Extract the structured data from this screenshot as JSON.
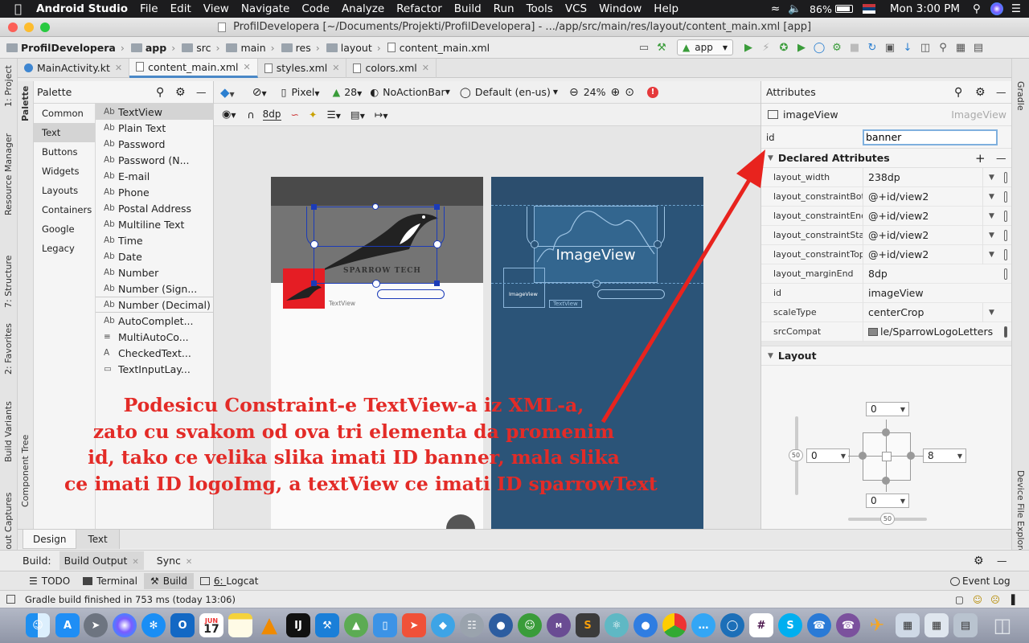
{
  "menubar": {
    "app": "Android Studio",
    "items": [
      "File",
      "Edit",
      "View",
      "Navigate",
      "Code",
      "Analyze",
      "Refactor",
      "Build",
      "Run",
      "Tools",
      "VCS",
      "Window",
      "Help"
    ],
    "battery": "86%",
    "clock": "Mon 3:00 PM"
  },
  "window": {
    "title": "ProfilDevelopera [~/Documents/Projekti/ProfilDevelopera] - .../app/src/main/res/layout/content_main.xml [app]"
  },
  "breadcrumbs": [
    "ProfilDevelopera",
    "app",
    "src",
    "main",
    "res",
    "layout",
    "content_main.xml"
  ],
  "run_config": "app",
  "editor_tabs": [
    {
      "label": "MainActivity.kt",
      "active": false
    },
    {
      "label": "content_main.xml",
      "active": true
    },
    {
      "label": "styles.xml",
      "active": false
    },
    {
      "label": "colors.xml",
      "active": false
    }
  ],
  "left_strip": [
    "1: Project",
    "Resource Manager",
    "7: Structure",
    "2: Favorites",
    "Build Variants",
    "Layout Captures"
  ],
  "right_strip": [
    "Gradle",
    "Device File Explorer"
  ],
  "palette": {
    "title": "Palette",
    "strip_label": "Palette",
    "tree_label": "Component Tree",
    "categories": [
      "Common",
      "Text",
      "Buttons",
      "Widgets",
      "Layouts",
      "Containers",
      "Google",
      "Legacy"
    ],
    "selected_category": "Text",
    "items": [
      {
        "icon": "Ab",
        "label": "TextView"
      },
      {
        "icon": "Ab",
        "label": "Plain Text"
      },
      {
        "icon": "Ab",
        "label": "Password"
      },
      {
        "icon": "Ab",
        "label": "Password (N..."
      },
      {
        "icon": "Ab",
        "label": "E-mail"
      },
      {
        "icon": "Ab",
        "label": "Phone"
      },
      {
        "icon": "Ab",
        "label": "Postal Address"
      },
      {
        "icon": "Ab",
        "label": "Multiline Text"
      },
      {
        "icon": "Ab",
        "label": "Time"
      },
      {
        "icon": "Ab",
        "label": "Date"
      },
      {
        "icon": "Ab",
        "label": "Number"
      },
      {
        "icon": "Ab",
        "label": "Number (Sign..."
      },
      {
        "icon": "Ab",
        "label": "Number (Decimal)"
      },
      {
        "icon": "Ab",
        "label": "AutoComplet..."
      },
      {
        "icon": "",
        "label": "MultiAutoCo..."
      },
      {
        "icon": "A",
        "label": "CheckedText..."
      },
      {
        "icon": "",
        "label": "TextInputLay..."
      }
    ]
  },
  "design_toolbar": {
    "device": "Pixel",
    "api": "28",
    "theme": "NoActionBar",
    "locale": "Default (en-us)",
    "zoom": "24%",
    "margin": "8dp"
  },
  "canvas": {
    "logo_text": "SPARROW TECH",
    "textview_label": "TextView",
    "blueprint_imageview": "ImageView",
    "blueprint_small_imageview": "ImageView",
    "blueprint_textview": "TextView"
  },
  "overlay_lines": [
    "Podesicu Constraint-e TextView-a iz XML-a,",
    "zato cu svakom od ova tri elementa da promenim",
    "id, tako ce velika slika imati ID banner, mala slika",
    "ce imati ID logoImg, a textView ce imati ID sparrowText"
  ],
  "attributes": {
    "title": "Attributes",
    "component": "imageView",
    "component_type": "ImageView",
    "id_label": "id",
    "id_value": "banner",
    "declared_title": "Declared Attributes",
    "rows": [
      {
        "k": "layout_width",
        "v": "238dp",
        "control": "dd"
      },
      {
        "k": "layout_constraintBotto",
        "v": "@+id/view2",
        "control": "dd"
      },
      {
        "k": "layout_constraintEnd_",
        "v": "@+id/view2",
        "control": "dd"
      },
      {
        "k": "layout_constraintStart",
        "v": "@+id/view2",
        "control": "dd"
      },
      {
        "k": "layout_constraintTop_",
        "v": "@+id/view2",
        "control": "dd"
      },
      {
        "k": "layout_marginEnd",
        "v": "8dp",
        "control": "pill"
      },
      {
        "k": "id",
        "v": "imageView",
        "control": "none"
      },
      {
        "k": "scaleType",
        "v": "centerCrop",
        "control": "dd"
      },
      {
        "k": "srcCompat",
        "v": "le/SparrowLogoLetters",
        "control": "img"
      }
    ],
    "layout_title": "Layout",
    "margins": {
      "top": "0",
      "left": "0",
      "right": "8",
      "bottom": "0",
      "bias_v": "50",
      "bias_h": "50"
    }
  },
  "design_tabs": [
    "Design",
    "Text"
  ],
  "build_bar": {
    "label": "Build:",
    "tabs": [
      "Build Output",
      "Sync"
    ]
  },
  "tool_windows": [
    {
      "label": "TODO",
      "key": ""
    },
    {
      "label": "Terminal",
      "key": ""
    },
    {
      "label": "Build",
      "key": ""
    },
    {
      "label": "Logcat",
      "key": "6: "
    }
  ],
  "event_log": "Event Log",
  "status": "Gradle build finished in 753 ms (today 13:06)",
  "dock_calendar": {
    "month": "JUN",
    "day": "17"
  }
}
